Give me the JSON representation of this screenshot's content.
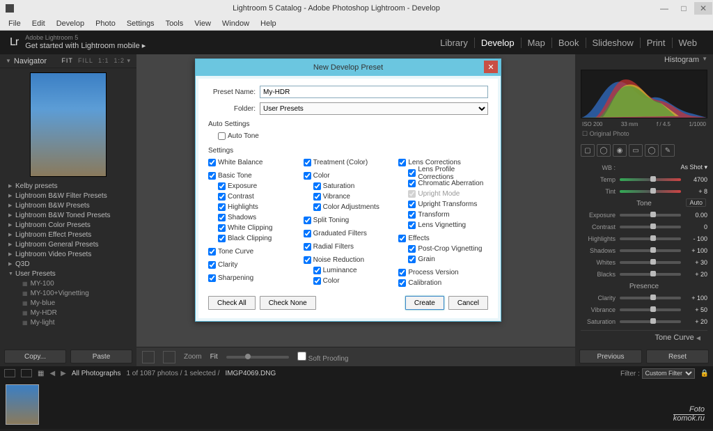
{
  "titlebar": {
    "title": "Lightroom 5 Catalog - Adobe Photoshop Lightroom - Develop"
  },
  "menubar": [
    "File",
    "Edit",
    "Develop",
    "Photo",
    "Settings",
    "Tools",
    "View",
    "Window",
    "Help"
  ],
  "header": {
    "brand": "Lr",
    "tag_small": "Adobe Lightroom 5",
    "tag_large": "Get started with Lightroom mobile  ▸"
  },
  "modules": [
    "Library",
    "Develop",
    "Map",
    "Book",
    "Slideshow",
    "Print",
    "Web"
  ],
  "active_module": "Develop",
  "nav": {
    "title": "Navigator",
    "fit_opts": "FIT  FILL  1:1  1:2 ▾"
  },
  "preset_folders": [
    {
      "label": "Kelby presets",
      "open": false
    },
    {
      "label": "Lightroom B&W Filter Presets",
      "open": false
    },
    {
      "label": "Lightroom B&W Presets",
      "open": false
    },
    {
      "label": "Lightroom B&W Toned Presets",
      "open": false
    },
    {
      "label": "Lightroom Color Presets",
      "open": false
    },
    {
      "label": "Lightroom Effect Presets",
      "open": false
    },
    {
      "label": "Lightroom General Presets",
      "open": false
    },
    {
      "label": "Lightroom Video Presets",
      "open": false
    },
    {
      "label": "Q3D",
      "open": false
    },
    {
      "label": "User Presets",
      "open": true,
      "children": [
        "MY-100",
        "MY-100+Vignetting",
        "My-blue",
        "My-HDR",
        "My-light"
      ]
    }
  ],
  "left_buttons": {
    "copy": "Copy...",
    "paste": "Paste"
  },
  "center_toolbar": {
    "zoom": "Zoom",
    "fit": "Fit",
    "softproof": "Soft Proofing"
  },
  "histogram": {
    "title": "Histogram",
    "iso": "ISO 200",
    "focal": "33 mm",
    "aperture": "f / 4.5",
    "shutter": "1/1000",
    "orig": "Original Photo"
  },
  "basic": {
    "wb_label": "WB :",
    "wb_value": "As Shot ▾",
    "temp_label": "Temp",
    "temp_val": "4700",
    "tint_label": "Tint",
    "tint_val": "+ 8",
    "tone_hdr": "Tone",
    "auto": "Auto",
    "exposure": "Exposure",
    "exposure_val": "0.00",
    "contrast": "Contrast",
    "contrast_val": "0",
    "highlights": "Highlights",
    "highlights_val": "- 100",
    "shadows": "Shadows",
    "shadows_val": "+ 100",
    "whites": "Whites",
    "whites_val": "+ 30",
    "blacks": "Blacks",
    "blacks_val": "+ 20",
    "presence": "Presence",
    "clarity": "Clarity",
    "clarity_val": "+ 100",
    "vibrance": "Vibrance",
    "vibrance_val": "+ 50",
    "saturation": "Saturation",
    "saturation_val": "+ 20",
    "tone_curve": "Tone Curve"
  },
  "right_buttons": {
    "prev": "Previous",
    "reset": "Reset"
  },
  "dialog": {
    "title": "New Develop Preset",
    "name_label": "Preset Name:",
    "name_value": "My-HDR",
    "folder_label": "Folder:",
    "folder_value": "User Presets",
    "auto_hdr": "Auto Settings",
    "auto_tone": "Auto Tone",
    "settings_hdr": "Settings",
    "col1": [
      {
        "label": "White Balance",
        "checked": true,
        "children": []
      },
      {
        "label": "Basic Tone",
        "checked": true,
        "children": [
          "Exposure",
          "Contrast",
          "Highlights",
          "Shadows",
          "White Clipping",
          "Black Clipping"
        ]
      },
      {
        "label": "Tone Curve",
        "checked": true,
        "children": []
      },
      {
        "label": "Clarity",
        "checked": true,
        "children": []
      },
      {
        "label": "Sharpening",
        "checked": true,
        "children": []
      }
    ],
    "col2": [
      {
        "label": "Treatment (Color)",
        "checked": true,
        "children": []
      },
      {
        "label": "Color",
        "checked": true,
        "children": [
          "Saturation",
          "Vibrance",
          "Color Adjustments"
        ]
      },
      {
        "label": "Split Toning",
        "checked": true,
        "children": []
      },
      {
        "label": "Graduated Filters",
        "checked": true,
        "children": []
      },
      {
        "label": "Radial Filters",
        "checked": true,
        "children": []
      },
      {
        "label": "Noise Reduction",
        "checked": true,
        "children": [
          "Luminance",
          "Color"
        ]
      }
    ],
    "col3": [
      {
        "label": "Lens Corrections",
        "checked": true,
        "children": [
          {
            "label": "Lens Profile Corrections",
            "checked": true
          },
          {
            "label": "Chromatic Aberration",
            "checked": true
          },
          {
            "label": "Upright Mode",
            "checked": true,
            "disabled": true
          },
          {
            "label": "Upright Transforms",
            "checked": true
          },
          {
            "label": "Transform",
            "checked": true
          },
          {
            "label": "Lens Vignetting",
            "checked": true
          }
        ]
      },
      {
        "label": "Effects",
        "checked": true,
        "children": [
          {
            "label": "Post-Crop Vignetting",
            "checked": true
          },
          {
            "label": "Grain",
            "checked": true
          }
        ]
      },
      {
        "label": "Process Version",
        "checked": true,
        "children": []
      },
      {
        "label": "Calibration",
        "checked": true,
        "children": []
      }
    ],
    "check_all": "Check All",
    "check_none": "Check None",
    "create": "Create",
    "cancel": "Cancel"
  },
  "filterbar": {
    "all": "All Photographs",
    "count": "1 of 1087 photos / 1 selected /",
    "file": "IMGP4069.DNG",
    "filter_label": "Filter :",
    "filter_value": "Custom Filter"
  },
  "watermark": {
    "l1": "Foto",
    "l2": "komok.ru"
  }
}
